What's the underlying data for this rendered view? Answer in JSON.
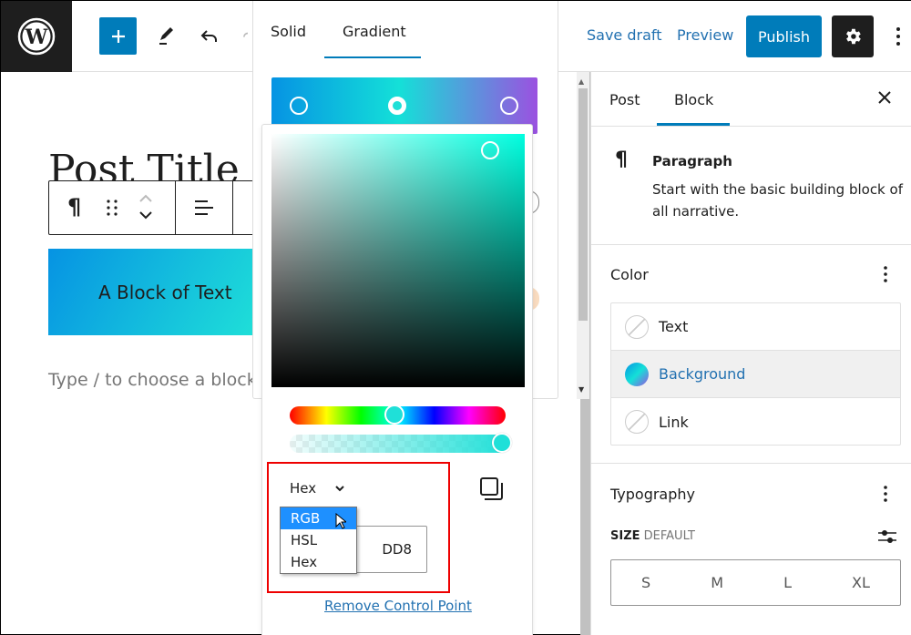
{
  "topbar": {
    "logo": "wordpress-logo",
    "add_block_icon": "plus-icon",
    "tools_icon": "pencil-icon",
    "undo_icon": "undo-icon",
    "redo_icon": "redo-icon",
    "save_draft": "Save draft",
    "preview": "Preview",
    "publish": "Publish",
    "settings_icon": "gear-icon",
    "options_icon": "more-vertical-icon"
  },
  "editor": {
    "post_title": "Post Title",
    "block_text": "A Block of Text",
    "placeholder": "Type / to choose a block",
    "toolbar": {
      "paragraph_icon": "¶",
      "drag_icon": "drag-handle-icon",
      "move_icon": "move-up-down-icon",
      "align_icon": "align-left-icon"
    }
  },
  "gradient_popover": {
    "tabs": [
      {
        "label": "Solid",
        "active": false
      },
      {
        "label": "Gradient",
        "active": true
      }
    ],
    "gradient_colors": [
      "#0693e3",
      "#14e0d8",
      "#9b51e0"
    ],
    "control_points": [
      {
        "position_pct": 10,
        "selected": false
      },
      {
        "position_pct": 47,
        "selected": true
      },
      {
        "position_pct": 90,
        "selected": false
      }
    ]
  },
  "color_picker": {
    "selected_color": "#1fe0d8",
    "hue_pct": 48,
    "alpha_pct": 100,
    "format_label": "Hex",
    "hex_value_visible": "DD8",
    "dropdown_options": [
      {
        "label": "RGB",
        "highlighted": true
      },
      {
        "label": "HSL",
        "highlighted": false
      },
      {
        "label": "Hex",
        "highlighted": false
      }
    ],
    "remove_link": "Remove Control Point"
  },
  "sidebar": {
    "tabs": [
      {
        "label": "Post",
        "active": false
      },
      {
        "label": "Block",
        "active": true
      }
    ],
    "block": {
      "icon": "¶",
      "name": "Paragraph",
      "description": "Start with the basic building block of all narrative."
    },
    "color_panel": {
      "title": "Color",
      "items": [
        {
          "label": "Text",
          "swatch": "none",
          "selected": false
        },
        {
          "label": "Background",
          "swatch": "gradient",
          "selected": true
        },
        {
          "label": "Link",
          "swatch": "none",
          "selected": false
        }
      ]
    },
    "typography_panel": {
      "title": "Typography",
      "size_label": "SIZE",
      "size_value": "DEFAULT",
      "sizes": [
        "S",
        "M",
        "L",
        "XL"
      ]
    }
  },
  "colors": {
    "accent": "#007cba",
    "link": "#2271b1",
    "highlight_box": "#ee0000",
    "dropdown_highlight": "#1e90ff"
  }
}
